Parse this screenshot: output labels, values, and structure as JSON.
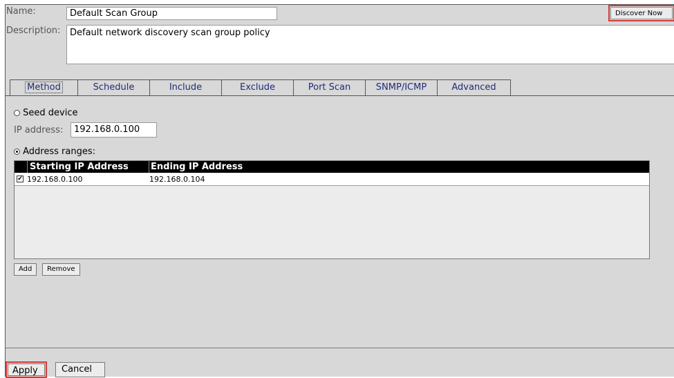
{
  "form": {
    "name_label": "Name:",
    "name_value": "Default Scan Group",
    "description_label": "Description:",
    "description_value": "Default network discovery scan group policy",
    "discover_now_label": "Discover Now"
  },
  "tabs": [
    {
      "label": "Method",
      "active": true
    },
    {
      "label": "Schedule"
    },
    {
      "label": "Include"
    },
    {
      "label": "Exclude"
    },
    {
      "label": "Port Scan"
    },
    {
      "label": "SNMP/ICMP"
    },
    {
      "label": "Advanced"
    }
  ],
  "method": {
    "seed_device_label": "Seed device",
    "seed_device_selected": false,
    "ip_address_label": "IP address:",
    "ip_address_value": "192.168.0.100",
    "address_ranges_label": "Address ranges:",
    "address_ranges_selected": true,
    "table": {
      "columns": [
        "Starting IP Address",
        "Ending IP Address"
      ],
      "rows": [
        {
          "checked": true,
          "start": "192.168.0.100",
          "end": "192.168.0.104"
        }
      ]
    },
    "add_label": "Add",
    "remove_label": "Remove"
  },
  "footer": {
    "apply_label": "Apply",
    "cancel_label": "Cancel"
  },
  "colors": {
    "highlight_border": "#d23a3a",
    "tab_text": "#1e2d7a",
    "panel_bg": "#d8d8d8"
  }
}
